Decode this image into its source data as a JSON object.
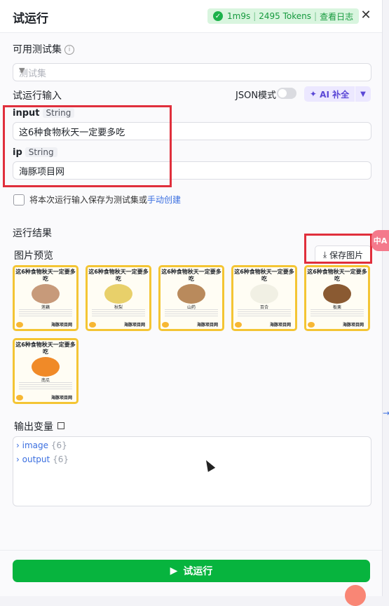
{
  "header": {
    "title": "试运行",
    "duration": "1m9s",
    "tokens": "2495 Tokens",
    "view_log": "查看日志",
    "close_icon": "close-icon"
  },
  "test_set": {
    "label": "可用测试集",
    "placeholder": "测试集"
  },
  "run_input": {
    "label": "试运行输入",
    "json_mode": "JSON模式",
    "ai_button": "AI 补全",
    "fields": [
      {
        "name": "input",
        "type": "String",
        "value": "这6种食物秋天一定要多吃"
      },
      {
        "name": "ip",
        "type": "String",
        "value": "海豚项目网"
      }
    ],
    "save_text": "将本次运行输入保存为测试集或",
    "manual_create": "手动创建"
  },
  "results": {
    "label": "运行结果",
    "preview_label": "图片预览",
    "save_image": "保存图片",
    "thumbs": [
      {
        "heading": "这6种食物秋天一定要多吃",
        "food": "莲藕",
        "brand": "海豚项目网",
        "color": "#c79a7a"
      },
      {
        "heading": "这6种食物秋天一定要多吃",
        "food": "秋梨",
        "brand": "海豚项目网",
        "color": "#e8d06a"
      },
      {
        "heading": "这6种食物秋天一定要多吃",
        "food": "山药",
        "brand": "海豚项目网",
        "color": "#b98a5c"
      },
      {
        "heading": "这6种食物秋天一定要多吃",
        "food": "百合",
        "brand": "海豚项目网",
        "color": "#f1f0e4"
      },
      {
        "heading": "这6种食物秋天一定要多吃",
        "food": "板栗",
        "brand": "海豚项目网",
        "color": "#8a5a32"
      },
      {
        "heading": "这6种食物秋天一定要多吃",
        "food": "南瓜",
        "brand": "海豚项目网",
        "color": "#f08a28"
      }
    ]
  },
  "output": {
    "label": "输出变量",
    "vars": [
      {
        "name": "image",
        "count": "{6}"
      },
      {
        "name": "output",
        "count": "{6}"
      }
    ]
  },
  "footer": {
    "run_button": "试运行"
  },
  "side": {
    "tab_text": "中A"
  },
  "colors": {
    "primary_green": "#07b43e",
    "highlight_red": "#e02f3c",
    "accent_purple": "#5a47d6",
    "link_blue": "#3b6fe0"
  }
}
